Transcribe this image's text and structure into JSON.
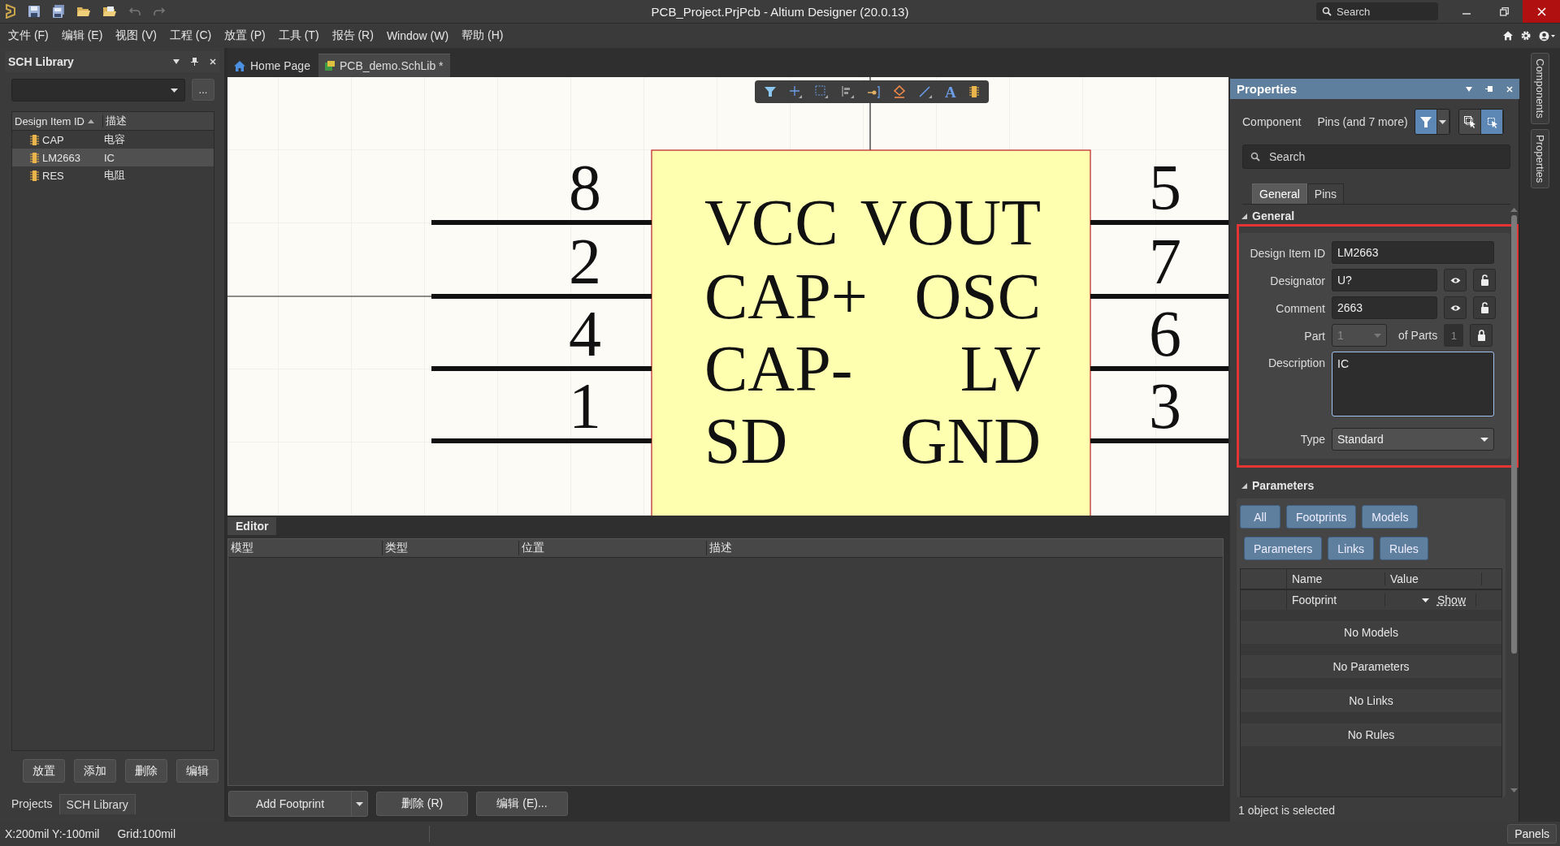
{
  "window": {
    "title": "PCB_Project.PrjPcb - Altium Designer (20.0.13)",
    "search_placeholder": "Search"
  },
  "menu": [
    "文件 (F)",
    "编辑 (E)",
    "视图 (V)",
    "工程 (C)",
    "放置 (P)",
    "工具 (T)",
    "报告 (R)",
    "Window (W)",
    "帮助 (H)"
  ],
  "left_panel": {
    "title": "SCH Library",
    "more_button": "...",
    "columns": [
      "Design Item ID",
      "描述"
    ],
    "rows": [
      {
        "id": "CAP",
        "description": "电容",
        "selected": false
      },
      {
        "id": "LM2663",
        "description": "IC",
        "selected": true
      },
      {
        "id": "RES",
        "description": "电阻",
        "selected": false
      }
    ],
    "buttons": [
      "放置",
      "添加",
      "删除",
      "编辑"
    ],
    "tabs": [
      {
        "label": "Projects",
        "selected": false
      },
      {
        "label": "SCH Library",
        "selected": true
      }
    ]
  },
  "doc_tabs": [
    {
      "label": "Home Page",
      "kind": "home",
      "selected": false
    },
    {
      "label": "PCB_demo.SchLib *",
      "kind": "schlib",
      "selected": true
    }
  ],
  "canvas_toolbar": {
    "text_tool_glyph": "A"
  },
  "schematic": {
    "left_pins": [
      {
        "number": "8",
        "name": "VCC"
      },
      {
        "number": "2",
        "name": "CAP+"
      },
      {
        "number": "4",
        "name": "CAP-"
      },
      {
        "number": "1",
        "name": "SD"
      }
    ],
    "right_pins": [
      {
        "number": "5",
        "name": "VOUT"
      },
      {
        "number": "7",
        "name": "OSC"
      },
      {
        "number": "6",
        "name": "LV"
      },
      {
        "number": "3",
        "name": "GND"
      }
    ]
  },
  "editor": {
    "title": "Editor",
    "columns": [
      "模型",
      "类型",
      "位置",
      "描述"
    ],
    "add_button": "Add Footprint",
    "buttons": [
      "删除 (R)",
      "编辑 (E)..."
    ]
  },
  "properties": {
    "title": "Properties",
    "filter_kind": "Component",
    "filter_summary": "Pins (and 7 more)",
    "selection_modes": [
      {
        "selected": false
      },
      {
        "selected": true
      }
    ],
    "search_placeholder": "Search",
    "tabs": [
      {
        "label": "General",
        "selected": true
      },
      {
        "label": "Pins",
        "selected": false
      }
    ],
    "general": {
      "title": "General",
      "expanded": true,
      "highlighted": true,
      "design_item_id": {
        "label": "Design Item ID",
        "value": "LM2663"
      },
      "designator": {
        "label": "Designator",
        "value": "U?"
      },
      "comment": {
        "label": "Comment",
        "value": "2663"
      },
      "part": {
        "label": "Part",
        "value": "1",
        "disabled": true,
        "of_label": "of Parts",
        "count": "1"
      },
      "description": {
        "label": "Description",
        "value": "IC",
        "focused": true
      },
      "type": {
        "label": "Type",
        "value": "Standard"
      }
    },
    "parameters": {
      "title": "Parameters",
      "expanded": true,
      "filter_rows": [
        [
          "All",
          "Footprints",
          "Models"
        ],
        [
          "Parameters",
          "Links",
          "Rules"
        ]
      ],
      "columns": [
        "Name",
        "Value"
      ],
      "rows": [
        {
          "name": "Footprint",
          "action": "Show"
        }
      ],
      "empty_sections": [
        "No Models",
        "No Parameters",
        "No Links",
        "No Rules"
      ]
    },
    "status": "1 object is selected"
  },
  "side_tabs": [
    "Components",
    "Properties"
  ],
  "status_bar": {
    "coords": "X:200mil Y:-100mil",
    "grid": "Grid:100mil",
    "panels_button": "Panels"
  }
}
